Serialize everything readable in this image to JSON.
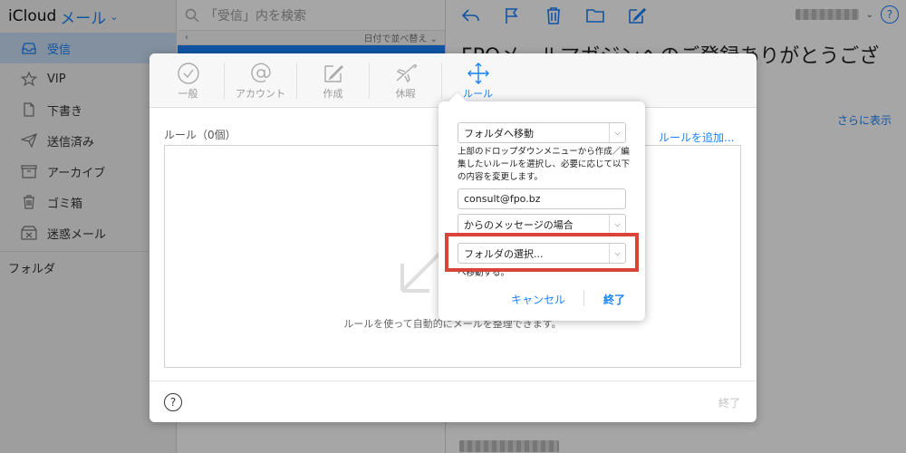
{
  "app": {
    "brand": "iCloud",
    "brand_app": "メール",
    "colors": {
      "accent": "#1a82fb",
      "highlight": "#d9443a"
    }
  },
  "sidebar": {
    "items": [
      {
        "label": "受信",
        "icon": "inbox-icon",
        "active": true
      },
      {
        "label": "VIP",
        "icon": "star-icon"
      },
      {
        "label": "下書き",
        "icon": "draft-icon"
      },
      {
        "label": "送信済み",
        "icon": "sent-icon"
      },
      {
        "label": "アーカイブ",
        "icon": "archive-icon"
      },
      {
        "label": "ゴミ箱",
        "icon": "trash-icon"
      },
      {
        "label": "迷惑メール",
        "icon": "junk-icon"
      }
    ],
    "folders_label": "フォルダ"
  },
  "list": {
    "search_placeholder": "「受信」内を検索",
    "sort_label": "日付で並べ替え"
  },
  "detail": {
    "subject": "FPOメールマガジンへのご登録ありがとうござ",
    "more_link": "さらに表示"
  },
  "dialog": {
    "tabs": [
      {
        "label": "一般",
        "icon": "check-circle-icon"
      },
      {
        "label": "アカウント",
        "icon": "at-sign-icon"
      },
      {
        "label": "作成",
        "icon": "compose-icon"
      },
      {
        "label": "休暇",
        "icon": "airplane-icon"
      },
      {
        "label": "ルール",
        "icon": "rules-arrows-icon",
        "active": true
      }
    ],
    "rules_label": "ルール（0個）",
    "add_rule": "ルールを追加...",
    "empty_text": "ルールを使って自動的にメールを整理できます。",
    "help": "?",
    "done": "終了"
  },
  "popover": {
    "action_select": "フォルダへ移動",
    "description": "上部のドロップダウンメニューから作成／編集したいルールを選択し、必要に応じて以下の内容を変更します。",
    "email_value": "consult@fpo.bz",
    "condition_select": "からのメッセージの場合",
    "folder_select": "フォルダの選択...",
    "tail_text": "へ移動する。",
    "cancel": "キャンセル",
    "done": "終了"
  }
}
